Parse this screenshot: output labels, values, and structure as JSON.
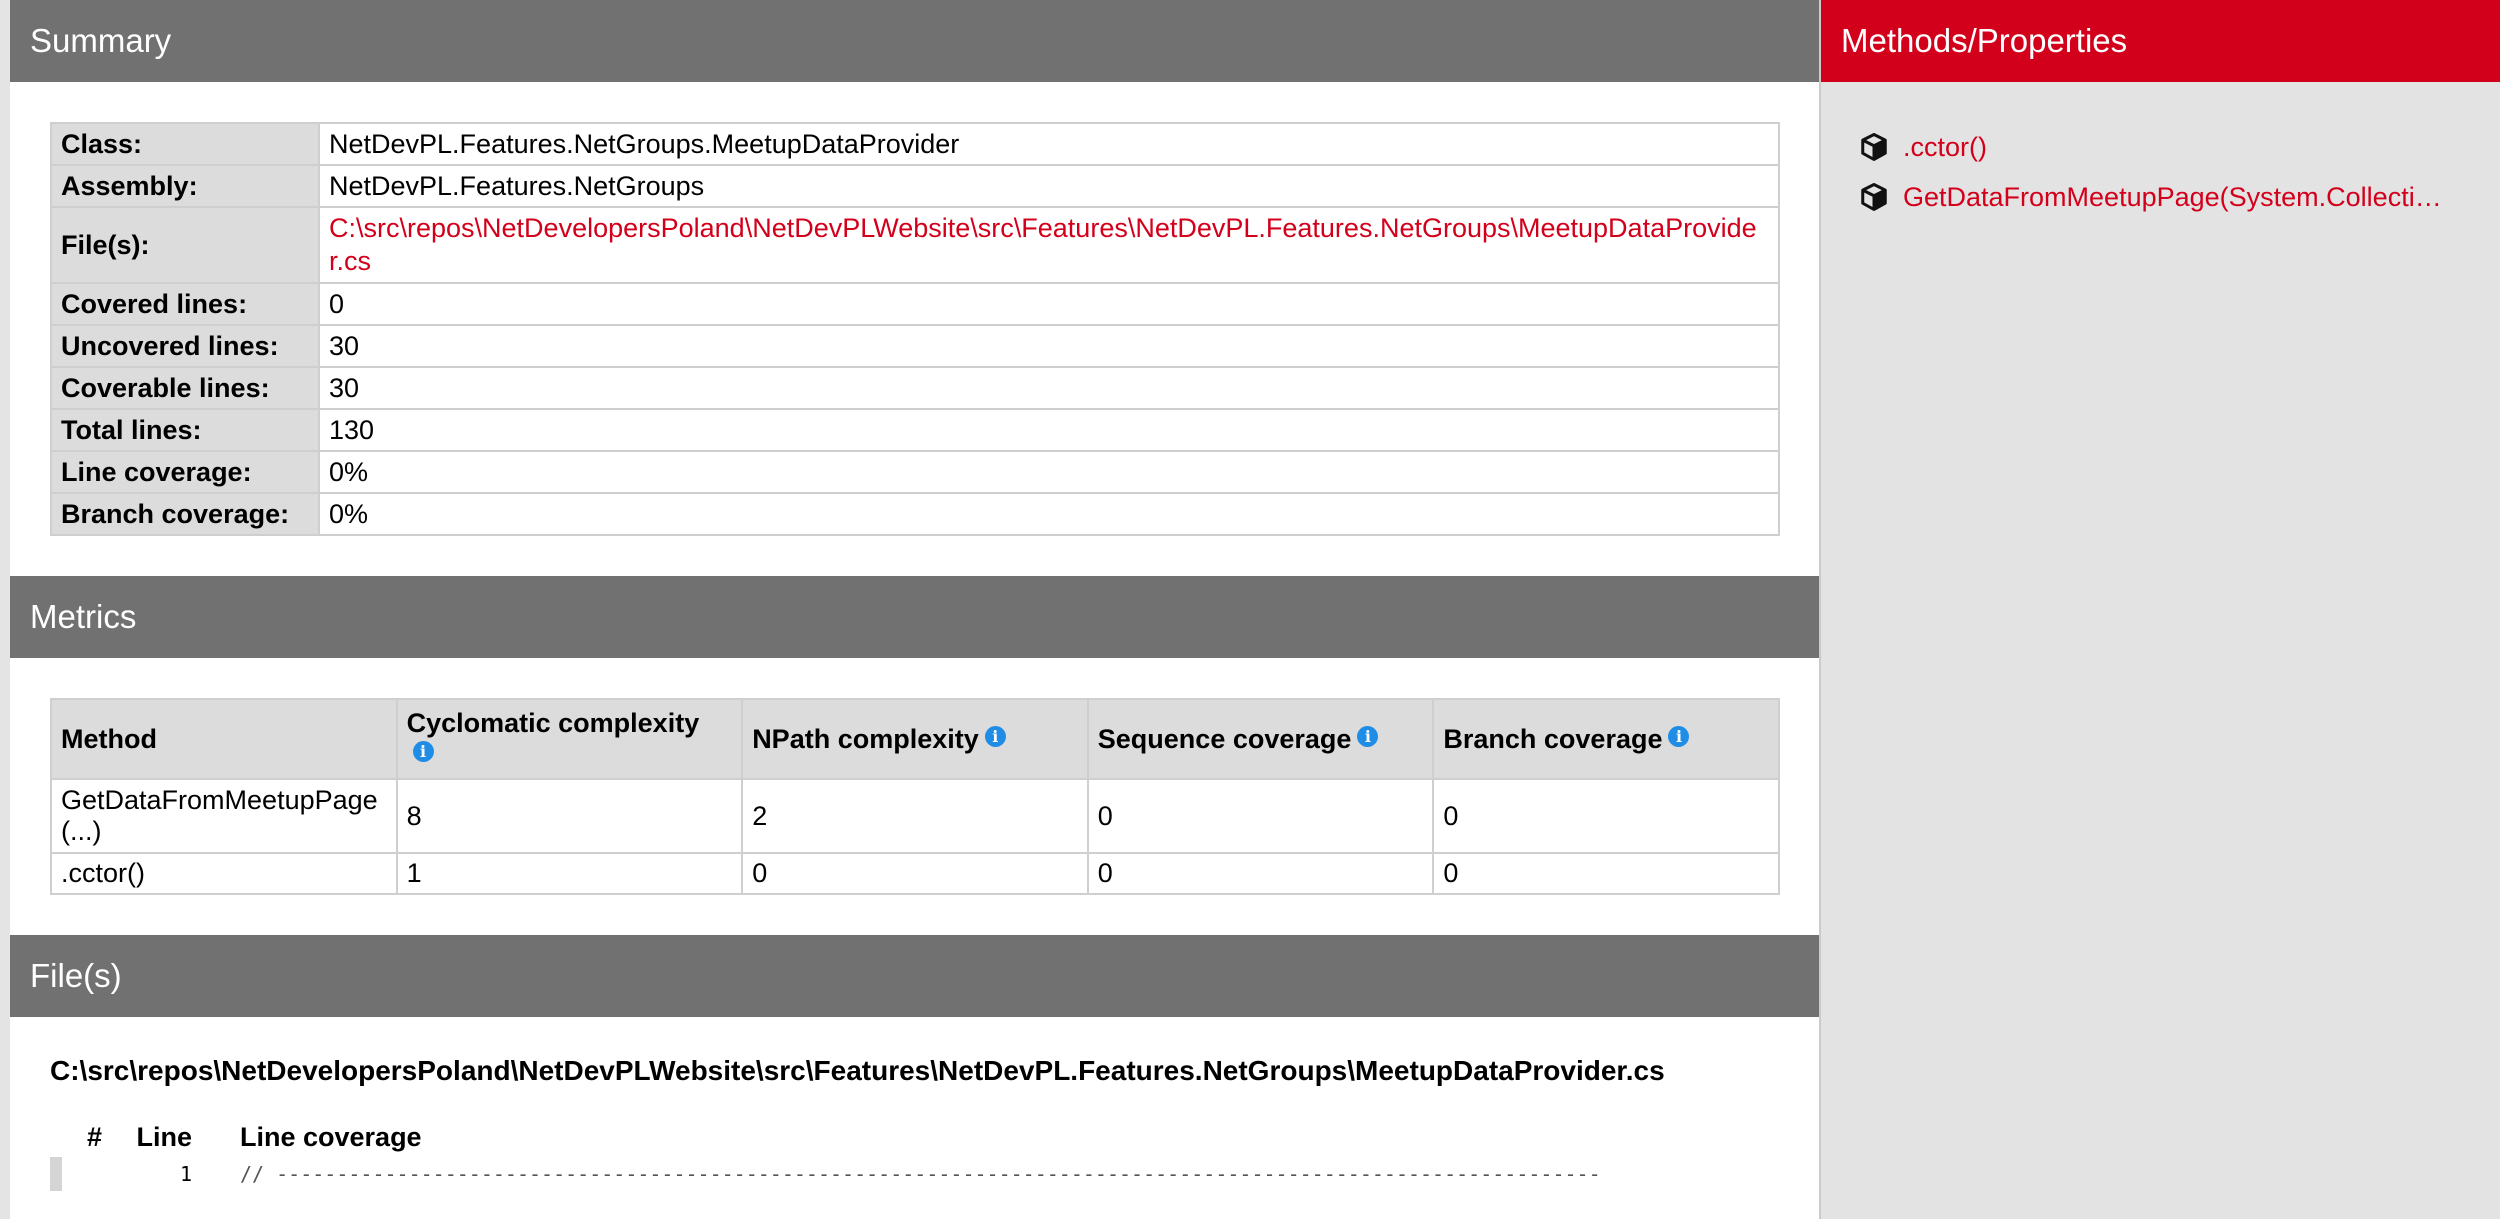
{
  "summary": {
    "header": "Summary",
    "rows": [
      {
        "label": "Class:",
        "value": "NetDevPL.Features.NetGroups.MeetupDataProvider"
      },
      {
        "label": "Assembly:",
        "value": "NetDevPL.Features.NetGroups"
      },
      {
        "label": "File(s):",
        "value": "C:\\src\\repos\\NetDevelopersPoland\\NetDevPLWebsite\\src\\Features\\NetDevPL.Features.NetGroups\\MeetupDataProvider.cs"
      },
      {
        "label": "Covered lines:",
        "value": "0"
      },
      {
        "label": "Uncovered lines:",
        "value": "30"
      },
      {
        "label": "Coverable lines:",
        "value": "30"
      },
      {
        "label": "Total lines:",
        "value": "130"
      },
      {
        "label": "Line coverage:",
        "value": "0%"
      },
      {
        "label": "Branch coverage:",
        "value": "0%"
      }
    ]
  },
  "metrics": {
    "header": "Metrics",
    "columns": [
      "Method",
      "Cyclomatic complexity",
      "NPath complexity",
      "Sequence coverage",
      "Branch coverage"
    ],
    "rows": [
      [
        "GetDataFromMeetupPage(...)",
        "8",
        "2",
        "0",
        "0"
      ],
      [
        ".cctor()",
        "1",
        "0",
        "0",
        "0"
      ]
    ]
  },
  "files": {
    "header": "File(s)",
    "path": "C:\\src\\repos\\NetDevelopersPoland\\NetDevPLWebsite\\src\\Features\\NetDevPL.Features.NetGroups\\MeetupDataProvider.cs",
    "columns": {
      "hash": "#",
      "line": "Line",
      "coverage": "Line coverage"
    },
    "lines": [
      {
        "number": "1",
        "text": "// --------------------------------------------------------------------------------------------------------------"
      }
    ]
  },
  "sidebar": {
    "header": "Methods/Properties",
    "items": [
      {
        "label": ".cctor()",
        "icon": "cube-icon"
      },
      {
        "label": "GetDataFromMeetupPage(System.Collections.Generic.List)",
        "icon": "cube-icon"
      }
    ]
  },
  "colors": {
    "accent": "#d3001b",
    "section_header": "#717171",
    "sidebar_bg": "#e3e3e3",
    "info_icon": "#1f8ce6"
  }
}
